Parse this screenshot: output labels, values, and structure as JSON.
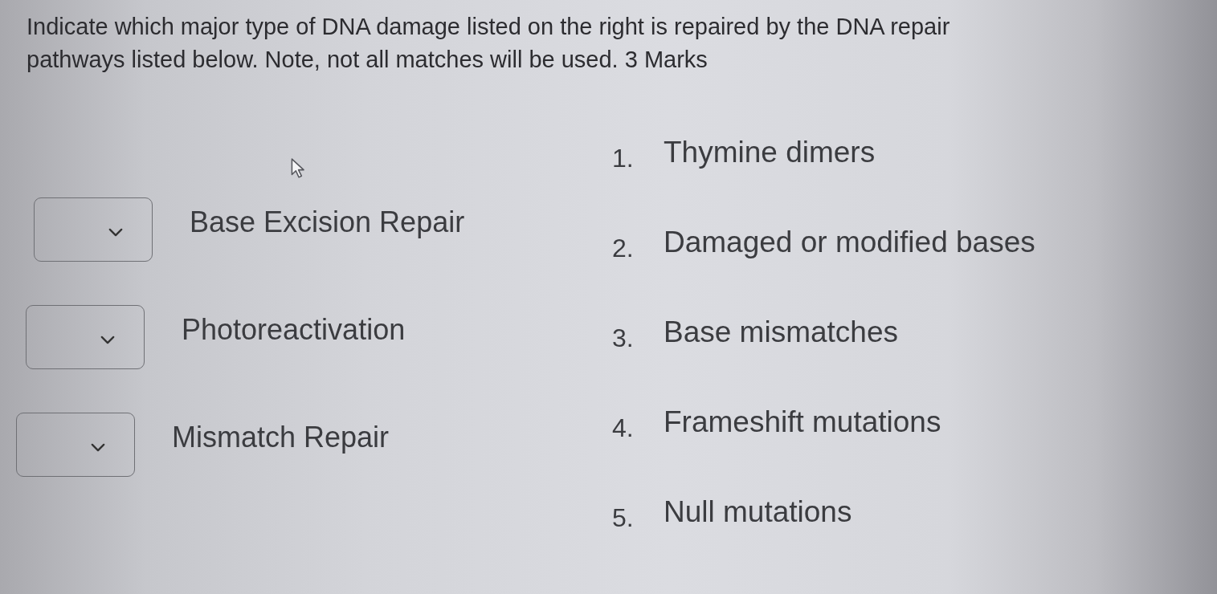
{
  "question": {
    "text": "Indicate which major type of DNA damage listed on the right is repaired by the DNA repair pathways listed below. Note, not all matches will be used. 3 Marks"
  },
  "pathways": [
    {
      "label": "Base Excision Repair"
    },
    {
      "label": "Photoreactivation"
    },
    {
      "label": "Mismatch Repair"
    }
  ],
  "damage_types": [
    {
      "number": "1.",
      "text": "Thymine dimers"
    },
    {
      "number": "2.",
      "text": "Damaged or modified bases"
    },
    {
      "number": "3.",
      "text": "Base mismatches"
    },
    {
      "number": "4.",
      "text": "Frameshift mutations"
    },
    {
      "number": "5.",
      "text": "Null mutations"
    }
  ]
}
